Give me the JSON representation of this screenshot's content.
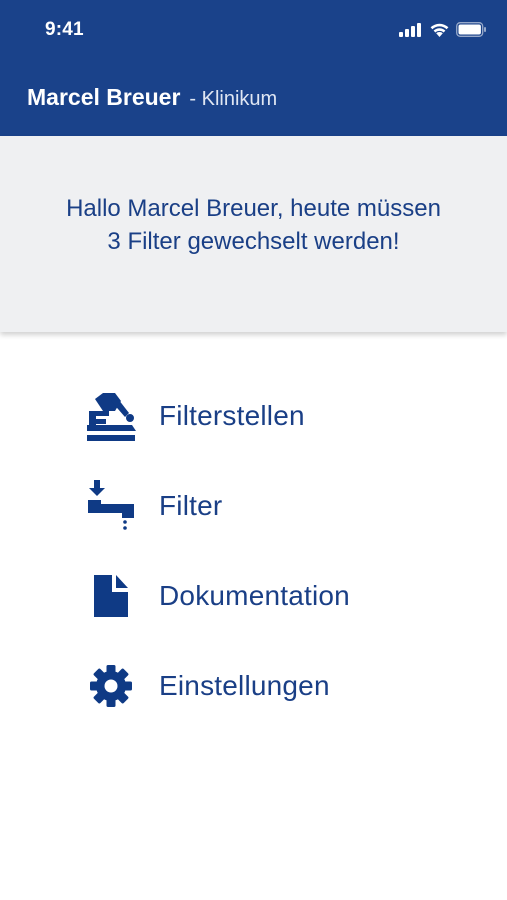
{
  "status_bar": {
    "time": "9:41",
    "icons": [
      "signal-icon",
      "wifi-icon",
      "battery-icon"
    ]
  },
  "header": {
    "user_name": "Marcel Breuer",
    "organization": "- Klinikum"
  },
  "banner": {
    "line1": "Hallo Marcel Breuer, heute müssen",
    "line2": "3 Filter gewechselt werden!"
  },
  "menu": {
    "items": [
      {
        "label": "Filterstellen",
        "icon": "filter-location-icon"
      },
      {
        "label": "Filter",
        "icon": "faucet-filter-icon"
      },
      {
        "label": "Dokumentation",
        "icon": "document-icon"
      },
      {
        "label": "Einstellungen",
        "icon": "gear-icon"
      }
    ]
  },
  "colors": {
    "header_bg": "#1a428a",
    "banner_bg": "#eff0f2",
    "accent_text": "#1a3f86",
    "icon": "#0f3a85"
  }
}
